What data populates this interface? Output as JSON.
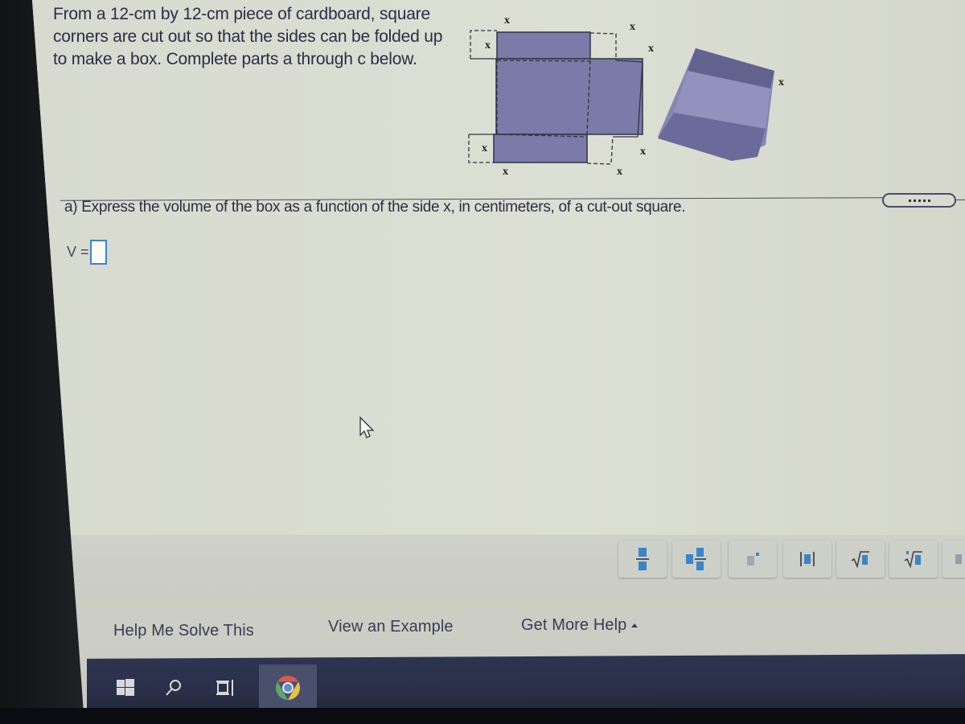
{
  "problem": {
    "lines": [
      "From a 12-cm by 12-cm piece of cardboard, square",
      "corners are cut out so that the sides can be folded up",
      "to make a box. Complete parts a through c below."
    ]
  },
  "diagram": {
    "side_label": "x",
    "fill_color": "#7b7aa8",
    "box_color": "#7d7cae"
  },
  "expand_button": {
    "label": "....."
  },
  "question": {
    "part_a": "a) Express the volume of the box as a function of the side x, in centimeters, of a cut-out square.",
    "answer_label": "V =",
    "answer_value": ""
  },
  "math_toolbar": {
    "tools": [
      {
        "name": "fraction",
        "icon": "fraction-icon"
      },
      {
        "name": "mixed-number",
        "icon": "mixed-number-icon"
      },
      {
        "name": "exponent",
        "icon": "exponent-icon"
      },
      {
        "name": "absolute-value",
        "icon": "absolute-value-icon"
      },
      {
        "name": "square-root",
        "icon": "square-root-icon"
      },
      {
        "name": "nth-root",
        "icon": "nth-root-icon"
      }
    ]
  },
  "help": {
    "help_me_solve": "Help Me Solve This",
    "view_example": "View an Example",
    "get_more_help": "Get More Help"
  },
  "taskbar": {
    "items": [
      "start",
      "search",
      "task-view",
      "chrome"
    ]
  },
  "colors": {
    "accent_blue": "#3a86c8",
    "text_dark": "#2d2c48",
    "taskbar": "#2d3450"
  }
}
